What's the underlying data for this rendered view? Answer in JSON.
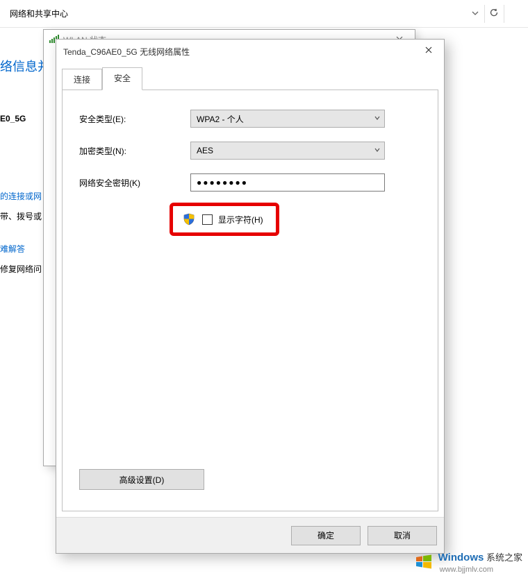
{
  "addressbar": {
    "path": "网络和共享中心",
    "dropdown_icon": "chevron-down",
    "refresh_icon": "refresh"
  },
  "background": {
    "heading_fragment": "络信息并",
    "network_name_fragment": "E0_5G",
    "conn_link_fragment": "的连接或网",
    "conn_text_fragment": "带、拨号或",
    "trouble_link_fragment": "难解答",
    "trouble_text_fragment": "修复网络问"
  },
  "wlan_status": {
    "title": "WLAN 状态"
  },
  "props": {
    "title": "Tenda_C96AE0_5G 无线网络属性",
    "tabs": {
      "connect": "连接",
      "security": "安全"
    },
    "security_type_label": "安全类型(E):",
    "security_type_value": "WPA2 - 个人",
    "encryption_label": "加密类型(N):",
    "encryption_value": "AES",
    "key_label": "网络安全密钥(K)",
    "key_value": "●●●●●●●●",
    "show_chars_label": "显示字符(H)",
    "advanced_button": "高级设置(D)",
    "ok_button": "确定",
    "cancel_button": "取消"
  },
  "watermark": {
    "brand": "Windows",
    "sub": "系统之家",
    "url": "www.bjjmlv.com"
  }
}
